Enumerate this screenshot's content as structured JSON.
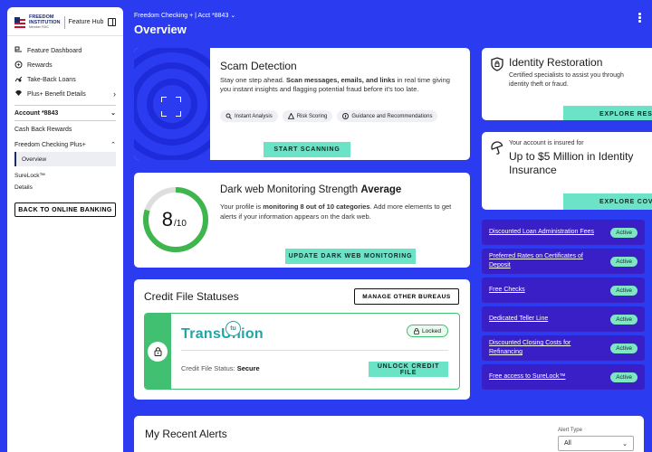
{
  "sidebar": {
    "logo_line1": "FREEDOM",
    "logo_line2": "INSTITUTION",
    "logo_sub": "Member FDIC",
    "hub": "Feature Hub",
    "nav": [
      {
        "label": "Feature Dashboard",
        "icon": "dashboard-icon"
      },
      {
        "label": "Rewards",
        "icon": "rewards-icon"
      },
      {
        "label": "Take-Back Loans",
        "icon": "loan-icon"
      },
      {
        "label": "Plus+ Benefit Details",
        "icon": "diamond-icon"
      }
    ],
    "account": "Account *8843",
    "cash_back": "Cash Back Rewards",
    "freedom": "Freedom Checking Plus+",
    "overview": "Overview",
    "surelock": "SureLock™",
    "details": "Details",
    "back": "BACK TO ONLINE BANKING"
  },
  "header": {
    "breadcrumb": "Freedom Checking + | Acct *8843",
    "title": "Overview"
  },
  "scam": {
    "title": "Scam Detection",
    "desc_a": "Stay one step ahead. ",
    "desc_bold": "Scan messages, emails, and links",
    "desc_b": " in real time giving you instant insights and flagging potential fraud before it's too late.",
    "chips": [
      "Instant Analysis",
      "Risk Scoring",
      "Guidance and Recommendations"
    ],
    "button": "START SCANNING"
  },
  "darkweb": {
    "title_a": "Dark web Monitoring Strength ",
    "title_bold": "Average",
    "score": "8",
    "out_of": "/10",
    "score_fraction": 0.8,
    "desc_a": "Your profile is ",
    "desc_bold": "monitoring 8 out of 10 categories",
    "desc_b": ". Add more elements to get alerts if your information appears on the dark web.",
    "button": "UPDATE DARK WEB MONITORING"
  },
  "credit": {
    "title": "Credit File Statuses",
    "manage": "MANAGE OTHER BUREAUS",
    "bureau": "TransUnion",
    "bureau_mark": "tu",
    "locked": "Locked",
    "status_label": "Credit File Status: ",
    "status_value": "Secure",
    "button": "UNLOCK CREDIT FILE"
  },
  "identity": {
    "title": "Identity Restoration",
    "desc": "Certified specialists to assist you through identity theft or fraud.",
    "button": "EXPLORE RESO"
  },
  "insurance": {
    "sub": "Your account is insured for",
    "main": "Up to $5 Million in Identity Insurance",
    "button": "EXPLORE COV"
  },
  "benefits": [
    {
      "label": "Discounted Loan Administration Fees",
      "status": "Active"
    },
    {
      "label": "Preferred Rates on Certificates of Deposit",
      "status": "Active"
    },
    {
      "label": "Free Checks",
      "status": "Active"
    },
    {
      "label": "Dedicated Teller Line",
      "status": "Active"
    },
    {
      "label": "Discounted Closing Costs for Refinancing",
      "status": "Active"
    },
    {
      "label": "Free access to SureLock™",
      "status": "Active"
    }
  ],
  "alerts": {
    "title": "My Recent Alerts",
    "filter_label": "Alert Type",
    "filter_value": "All"
  },
  "colors": {
    "brand_blue": "#2b3cf0",
    "accent_green": "#6be3c6",
    "lock_green": "#41c071",
    "benefit_purple": "#3a1fc6"
  }
}
